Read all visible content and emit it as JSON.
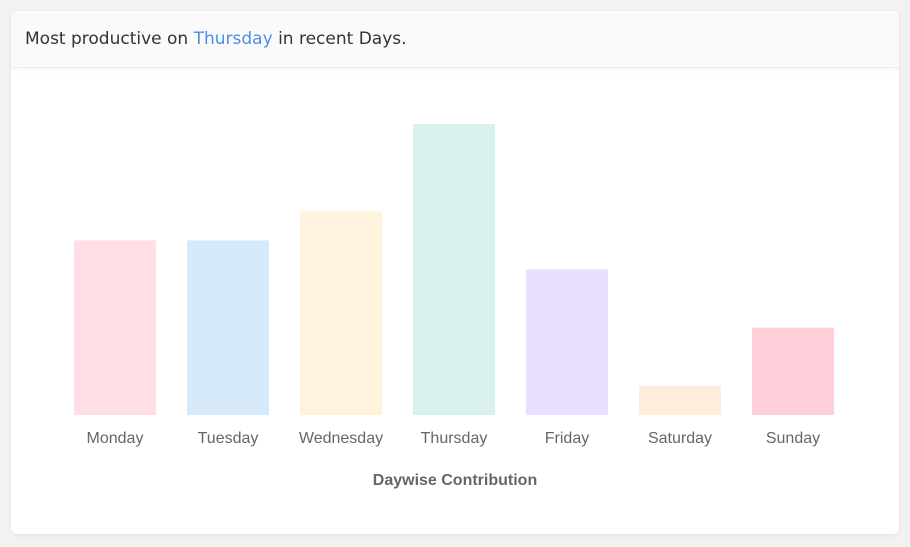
{
  "header": {
    "prefix": "Most productive on",
    "highlight": "Thursday",
    "suffix": "in recent Days.",
    "highlight_color": "#4a8fe7"
  },
  "chart_data": {
    "type": "bar",
    "title": "",
    "xlabel": "Daywise Contribution",
    "ylabel": "",
    "categories": [
      "Monday",
      "Tuesday",
      "Wednesday",
      "Thursday",
      "Friday",
      "Saturday",
      "Sunday"
    ],
    "values": [
      6,
      6,
      7,
      10,
      5,
      1,
      3
    ],
    "ylim": [
      0,
      10
    ],
    "grid": false,
    "legend": "none",
    "colors": [
      "#ffdfe5",
      "#d7eaf9",
      "#fff3de",
      "#daf2ef",
      "#ebdfff",
      "#ffeddb",
      "#ffcfda"
    ]
  }
}
